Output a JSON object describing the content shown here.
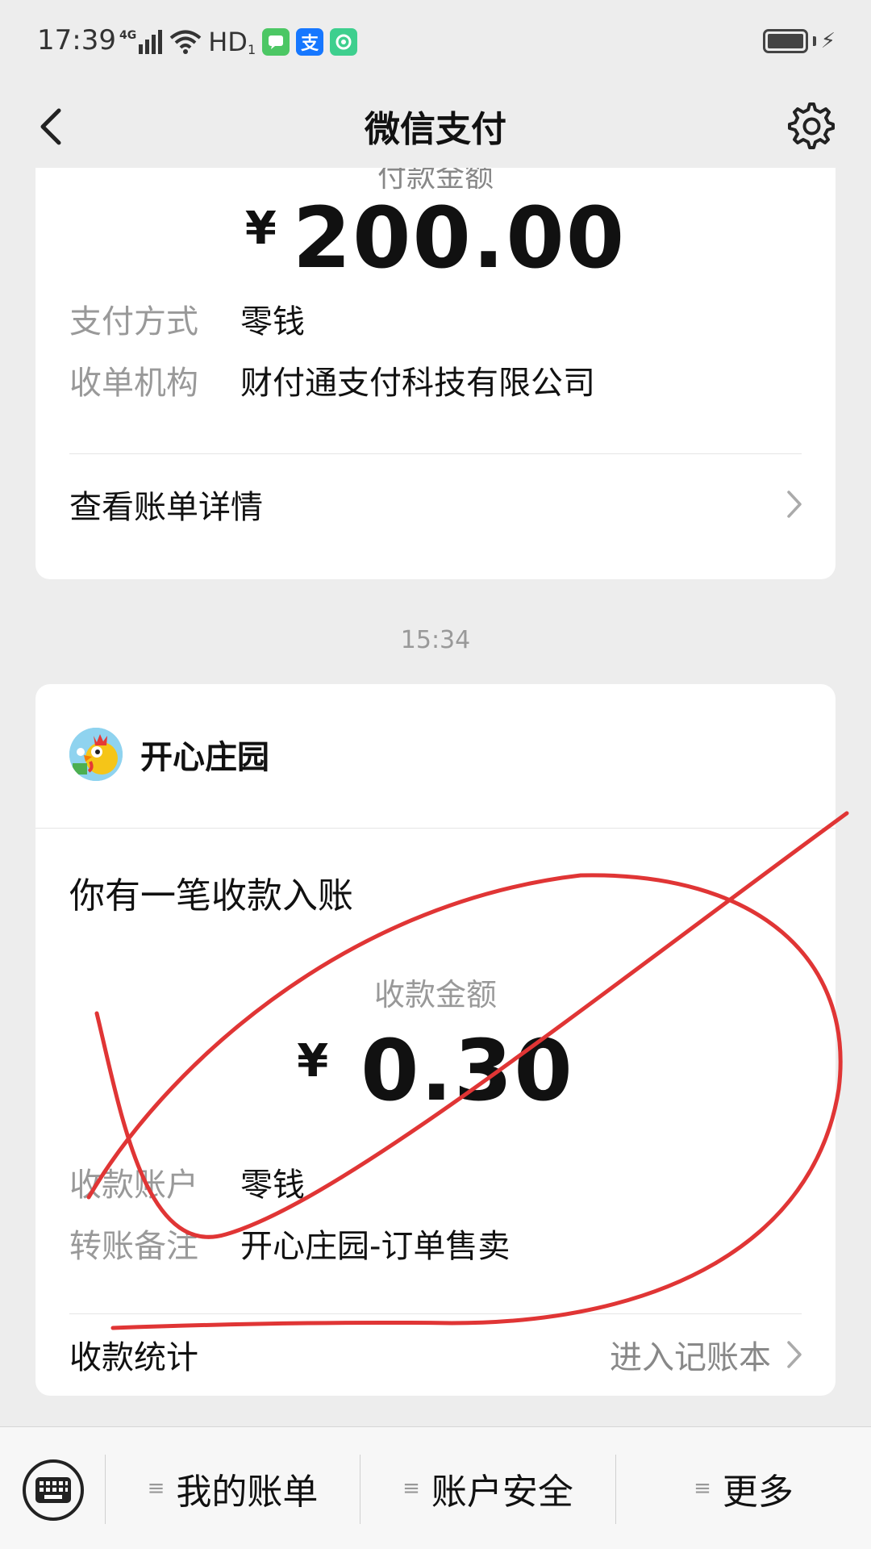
{
  "status_bar": {
    "time": "17:39",
    "network": "4G",
    "hd": "HD",
    "hd_sub": "1",
    "apps": [
      {
        "name": "messages-icon",
        "color": "#4cc764"
      },
      {
        "name": "alipay-icon",
        "color": "#1677ff"
      },
      {
        "name": "app-icon",
        "color": "#3ecf8e"
      }
    ]
  },
  "header": {
    "title": "微信支付"
  },
  "payment_card": {
    "label_cut": "付款金额",
    "currency": "¥",
    "amount": "200.00",
    "rows": [
      {
        "key": "支付方式",
        "value": "零钱"
      },
      {
        "key": "收单机构",
        "value": "财付通支付科技有限公司"
      }
    ],
    "link_label": "查看账单详情"
  },
  "timestamp": "15:34",
  "receipt_card": {
    "merchant": "开心庄园",
    "notice_title": "你有一笔收款入账",
    "sub_label": "收款金额",
    "currency": "¥",
    "amount": "0.30",
    "rows": [
      {
        "key": "收款账户",
        "value": "零钱"
      },
      {
        "key": "转账备注",
        "value": "开心庄园-订单售卖"
      }
    ],
    "link_label": "收款统计",
    "link_right": "进入记账本"
  },
  "bottom_menu": {
    "items": [
      {
        "label": "我的账单"
      },
      {
        "label": "账户安全"
      },
      {
        "label": "更多"
      }
    ]
  },
  "colors": {
    "annotation": "#e03535",
    "background": "#ededed"
  }
}
